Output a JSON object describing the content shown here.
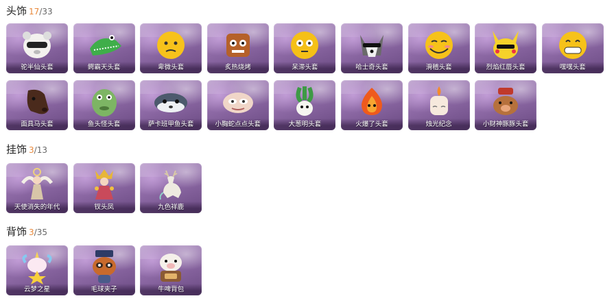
{
  "sections": [
    {
      "title": "头饰",
      "owned": "17",
      "total": "/33",
      "items": [
        {
          "label": "驼半仙头套",
          "icon": "panda-head-icon"
        },
        {
          "label": "鳄霸天头套",
          "icon": "crocodile-head-icon"
        },
        {
          "label": "卑微头套",
          "icon": "humble-emoji-icon"
        },
        {
          "label": "炙热烧烤",
          "icon": "toast-head-icon"
        },
        {
          "label": "呆滞头套",
          "icon": "dazed-emoji-icon"
        },
        {
          "label": "哈士奇头套",
          "icon": "husky-head-icon"
        },
        {
          "label": "滑稽头套",
          "icon": "funny-emoji-icon"
        },
        {
          "label": "烈焰红唇头套",
          "icon": "pikachu-head-icon"
        },
        {
          "label": "嘿嘿头套",
          "icon": "grin-emoji-icon"
        },
        {
          "label": "面具马头套",
          "icon": "horse-head-icon"
        },
        {
          "label": "鱼头怪头套",
          "icon": "fish-head-icon"
        },
        {
          "label": "萨卡班甲鱼头套",
          "icon": "sacabambaspis-head-icon"
        },
        {
          "label": "小胸蛇点点头套",
          "icon": "snake-head-icon"
        },
        {
          "label": "大葱明头套",
          "icon": "bok-choy-head-icon"
        },
        {
          "label": "火爆了头套",
          "icon": "fire-head-icon"
        },
        {
          "label": "烛光纪念",
          "icon": "candle-head-icon"
        },
        {
          "label": "小财神豚豚头套",
          "icon": "pig-head-icon"
        }
      ]
    },
    {
      "title": "挂饰",
      "owned": "3",
      "total": "/13",
      "items": [
        {
          "label": "天使消失的年代",
          "icon": "angel-figure-icon"
        },
        {
          "label": "钗头凤",
          "icon": "phoenix-figure-icon"
        },
        {
          "label": "九色祥鹿",
          "icon": "deer-figure-icon"
        }
      ]
    },
    {
      "title": "背饰",
      "owned": "3",
      "total": "/35",
      "items": [
        {
          "label": "云梦之星",
          "icon": "unicorn-star-icon"
        },
        {
          "label": "毛球夹子",
          "icon": "raccoon-clip-icon"
        },
        {
          "label": "牛啤背包",
          "icon": "cow-backpack-icon"
        }
      ]
    }
  ]
}
